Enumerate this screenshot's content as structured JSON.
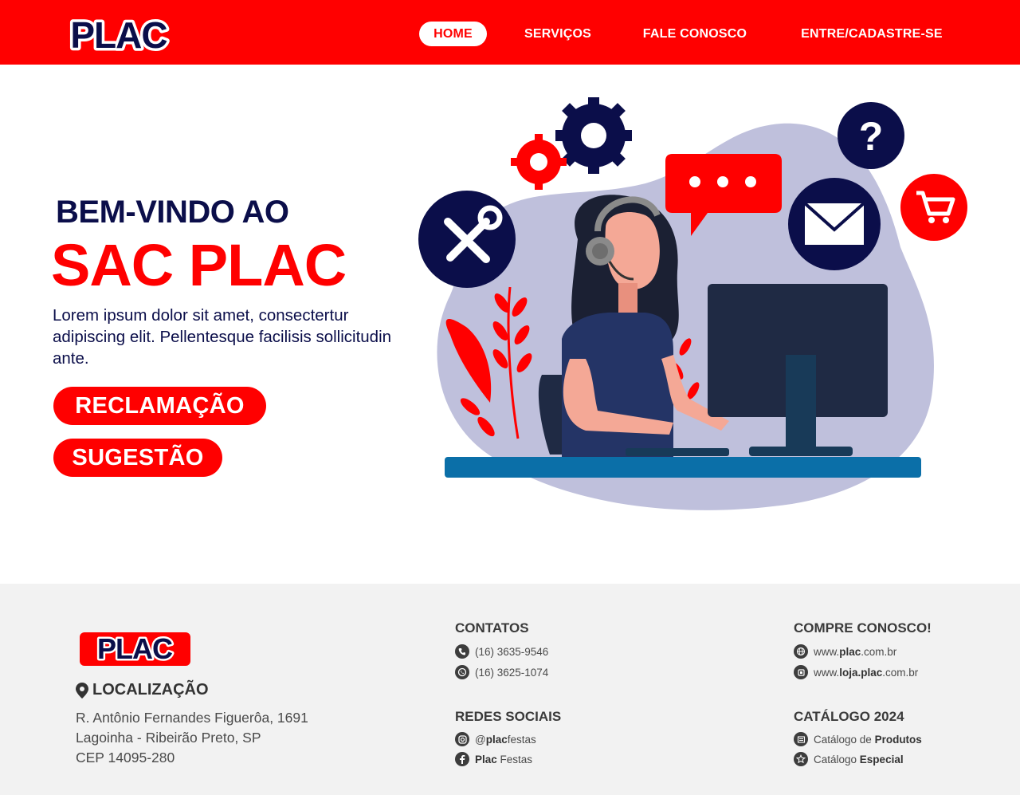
{
  "brand": {
    "logo_text": "PLAC",
    "primary_color": "#ff0000",
    "navy_color": "#0b0e4a"
  },
  "nav": {
    "items": [
      {
        "label": "HOME",
        "active": true
      },
      {
        "label": "SERVIÇOS"
      },
      {
        "label": "FALE CONOSCO"
      },
      {
        "label": "ENTRE/CADASTRE-SE"
      }
    ]
  },
  "hero": {
    "kicker": "BEM-VINDO AO",
    "title": "SAC PLAC",
    "description": "Lorem ipsum dolor sit amet, consectertur adipiscing elit. Pellentesque facilisis sollicitudin ante.",
    "buttons": {
      "complaint": "RECLAMAÇÃO",
      "suggestion": "SUGESTÃO"
    }
  },
  "footer": {
    "location": {
      "title": "LOCALIZAÇÃO",
      "lines": [
        "R. Antônio Fernandes Figuerôa, 1691",
        "Lagoinha - Ribeirão Preto, SP",
        "CEP 14095-280"
      ]
    },
    "contacts": {
      "title": "CONTATOS",
      "phone": "(16) 3635-9546",
      "whatsapp": "(16) 3625-1074"
    },
    "social": {
      "title": "REDES SOCIAIS",
      "instagram": {
        "prefix": "@",
        "bold": "plac",
        "rest": "festas"
      },
      "facebook": {
        "bold": "Plac",
        "rest": " Festas"
      }
    },
    "shop": {
      "title": "COMPRE CONOSCO!",
      "site": {
        "prefix": "www.",
        "bold": "plac",
        "rest": ".com.br"
      },
      "store": {
        "prefix": "www.",
        "bold": "loja.plac",
        "rest": ".com.br"
      }
    },
    "catalog": {
      "title": "CATÁLOGO 2024",
      "products": {
        "prefix": "Catálogo de ",
        "bold": "Produtos"
      },
      "special": {
        "prefix": "Catálogo ",
        "bold": "Especial"
      }
    }
  },
  "icons": [
    "phone-icon",
    "whatsapp-icon",
    "instagram-icon",
    "facebook-icon",
    "globe-icon",
    "store-icon",
    "catalog-icon",
    "star-icon",
    "location-pin-icon"
  ]
}
